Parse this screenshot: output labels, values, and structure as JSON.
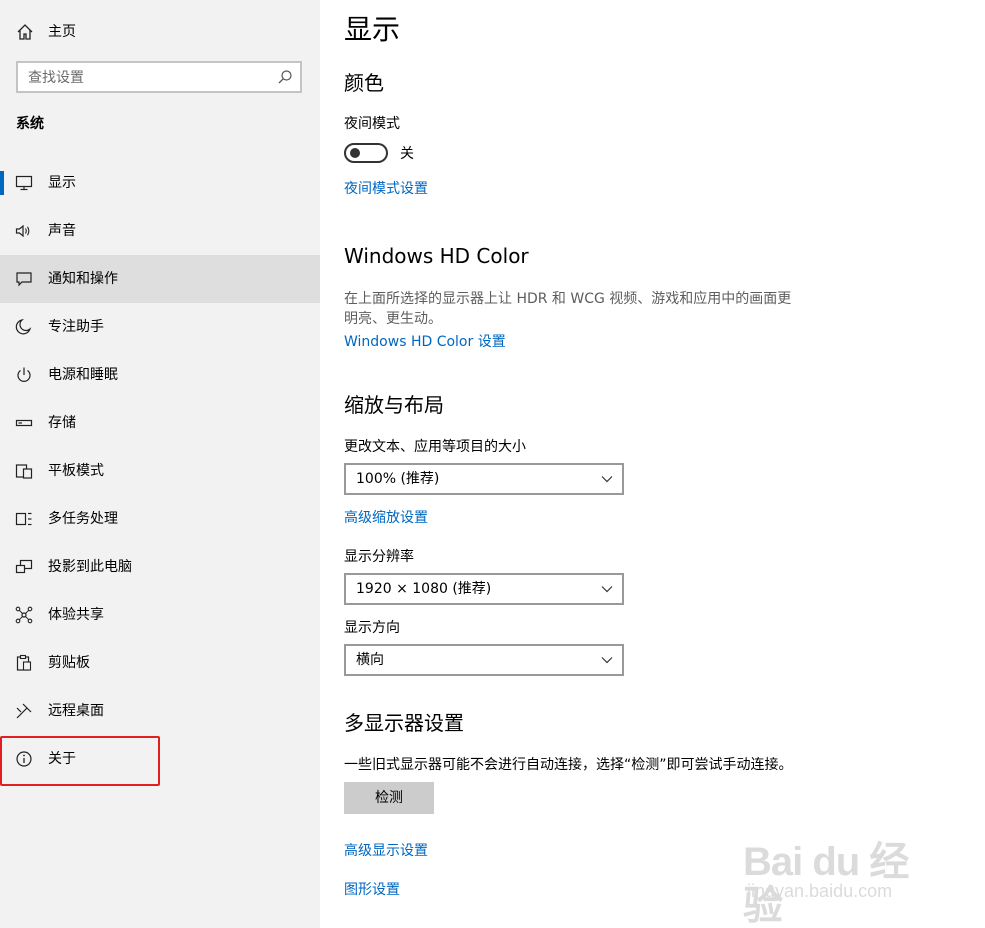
{
  "sidebar": {
    "home_label": "主页",
    "search_placeholder": "查找设置",
    "section_title": "系统",
    "items": [
      {
        "label": "显示",
        "icon": "monitor-icon"
      },
      {
        "label": "声音",
        "icon": "speaker-icon"
      },
      {
        "label": "通知和操作",
        "icon": "notification-icon"
      },
      {
        "label": "专注助手",
        "icon": "moon-icon"
      },
      {
        "label": "电源和睡眠",
        "icon": "power-icon"
      },
      {
        "label": "存储",
        "icon": "storage-icon"
      },
      {
        "label": "平板模式",
        "icon": "tablet-icon"
      },
      {
        "label": "多任务处理",
        "icon": "multitask-icon"
      },
      {
        "label": "投影到此电脑",
        "icon": "project-icon"
      },
      {
        "label": "体验共享",
        "icon": "share-icon"
      },
      {
        "label": "剪贴板",
        "icon": "clipboard-icon"
      },
      {
        "label": "远程桌面",
        "icon": "remote-desktop-icon"
      },
      {
        "label": "关于",
        "icon": "info-icon"
      }
    ],
    "selected_index": 0,
    "hover_index": 2
  },
  "main": {
    "title": "显示",
    "color": {
      "heading": "颜色",
      "night_light_label": "夜间模式",
      "night_light_state": "关",
      "night_light_on": false,
      "night_light_link": "夜间模式设置"
    },
    "hdr": {
      "heading": "Windows HD Color",
      "description": "在上面所选择的显示器上让 HDR 和 WCG 视频、游戏和应用中的画面更明亮、更生动。",
      "link": "Windows HD Color 设置"
    },
    "scale": {
      "heading": "缩放与布局",
      "text_size_label": "更改文本、应用等项目的大小",
      "text_size_value": "100% (推荐)",
      "advanced_scaling_link": "高级缩放设置",
      "resolution_label": "显示分辨率",
      "resolution_value": "1920 × 1080 (推荐)",
      "orientation_label": "显示方向",
      "orientation_value": "横向"
    },
    "multi": {
      "heading": "多显示器设置",
      "description": "一些旧式显示器可能不会进行自动连接，选择“检测”即可尝试手动连接。",
      "detect_button": "检测",
      "advanced_display_link": "高级显示设置",
      "graphics_link": "图形设置"
    }
  },
  "watermark": {
    "logo_text": "Bai du 经验",
    "url": "jingyan.baidu.com"
  },
  "colors": {
    "accent": "#0067c0",
    "sidebar_bg": "#f2f2f2",
    "hover_bg": "#dedede",
    "highlight_border": "#e02020"
  }
}
